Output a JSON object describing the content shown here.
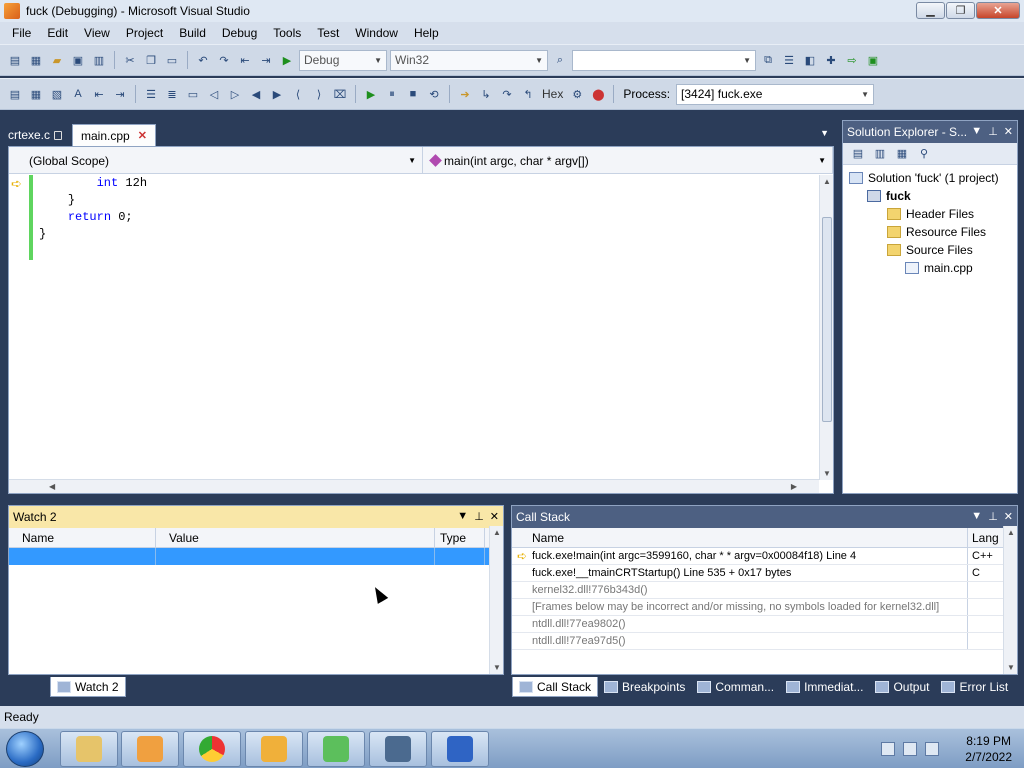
{
  "window": {
    "title": "fuck (Debugging) - Microsoft Visual Studio",
    "minimize": "▁",
    "restore": "❐",
    "close": "✕"
  },
  "menu": [
    "File",
    "Edit",
    "View",
    "Project",
    "Build",
    "Debug",
    "Tools",
    "Test",
    "Window",
    "Help"
  ],
  "toolbar1": {
    "configuration": "Debug",
    "platform": "Win32",
    "find": ""
  },
  "toolbar2": {
    "hex_label": "Hex",
    "process_label": "Process:",
    "process_value": "[3424] fuck.exe"
  },
  "tabs": [
    {
      "label": "crtexe.c",
      "active": false
    },
    {
      "label": "main.cpp",
      "active": true
    }
  ],
  "editor": {
    "scope": "(Global Scope)",
    "member": "main(int argc, char * argv[])",
    "code_lines": [
      {
        "indent": "        ",
        "kw": "int",
        "rest": " 12h"
      },
      {
        "indent": "    ",
        "kw": "",
        "rest": "}"
      },
      {
        "indent": "    ",
        "kw": "return",
        "rest": " 0;"
      },
      {
        "indent": "",
        "kw": "",
        "rest": "}"
      }
    ]
  },
  "solution_explorer": {
    "title": "Solution Explorer - S...",
    "solution": "Solution 'fuck' (1 project)",
    "project": "fuck",
    "folders": [
      "Header Files",
      "Resource Files",
      "Source Files"
    ],
    "file": "main.cpp"
  },
  "watch": {
    "title": "Watch 2",
    "columns": [
      "Name",
      "Value",
      "Type"
    ],
    "tab_label": "Watch 2"
  },
  "callstack": {
    "title": "Call Stack",
    "columns": [
      "Name",
      "Lang"
    ],
    "rows": [
      {
        "name": "fuck.exe!main(int argc=3599160, char * * argv=0x00084f18)  Line 4",
        "lang": "C++",
        "current": true,
        "gray": false
      },
      {
        "name": "fuck.exe!__tmainCRTStartup()  Line 535 + 0x17 bytes",
        "lang": "C",
        "current": false,
        "gray": false
      },
      {
        "name": "kernel32.dll!776b343d()",
        "lang": "",
        "current": false,
        "gray": true
      },
      {
        "name": "[Frames below may be incorrect and/or missing, no symbols loaded for kernel32.dll]",
        "lang": "",
        "current": false,
        "gray": true
      },
      {
        "name": "ntdll.dll!77ea9802()",
        "lang": "",
        "current": false,
        "gray": true
      },
      {
        "name": "ntdll.dll!77ea97d5()",
        "lang": "",
        "current": false,
        "gray": true
      }
    ]
  },
  "bottom_tabs": [
    "Call Stack",
    "Breakpoints",
    "Comman...",
    "Immediat...",
    "Output",
    "Error List"
  ],
  "status": "Ready",
  "clock": {
    "time": "8:19 PM",
    "date": "2/7/2022"
  },
  "colors": {
    "accent": "#3399ff",
    "panel_active": "#f9e7a8",
    "ide_bg": "#2b3c59"
  }
}
